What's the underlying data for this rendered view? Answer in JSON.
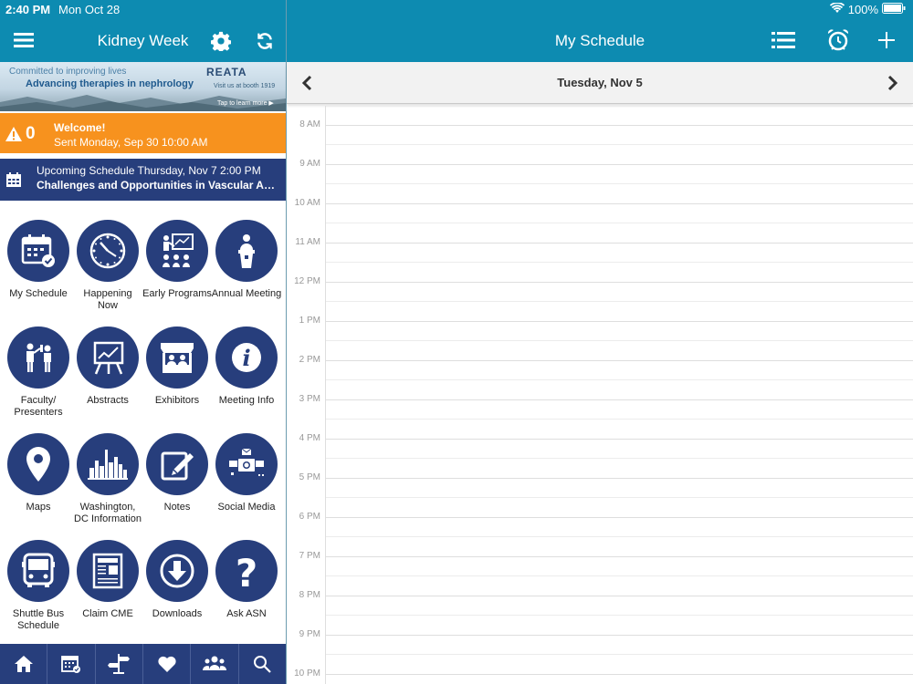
{
  "status": {
    "time": "2:40 PM",
    "date": "Mon Oct 28",
    "battery": "100%"
  },
  "left_header": {
    "title": "Kidney Week"
  },
  "right_header": {
    "title": "My Schedule"
  },
  "banner": {
    "tagline": "Committed to improving lives",
    "headline": "Advancing therapies in nephrology",
    "logo": "REATA",
    "booth": "Visit us at booth 1919",
    "cta": "Tap to learn more"
  },
  "alert": {
    "count": "0",
    "title": "Welcome!",
    "sent": "Sent Monday, Sep 30 10:00 AM"
  },
  "upcoming": {
    "line1": "Upcoming Schedule Thursday, Nov 7 2:00 PM",
    "line2": "Challenges and Opportunities in Vascular Access"
  },
  "tiles": [
    {
      "label": "My Schedule",
      "icon": "calendar-check-icon"
    },
    {
      "label": "Happening Now",
      "icon": "clock-icon"
    },
    {
      "label": "Early Programs",
      "icon": "presentation-audience-icon"
    },
    {
      "label": "Annual Meeting",
      "icon": "podium-speaker-icon"
    },
    {
      "label": "Faculty/ Presenters",
      "icon": "presenter-board-icon"
    },
    {
      "label": "Abstracts",
      "icon": "chart-easel-icon"
    },
    {
      "label": "Exhibitors",
      "icon": "booth-icon"
    },
    {
      "label": "Meeting Info",
      "icon": "info-icon"
    },
    {
      "label": "Maps",
      "icon": "map-pin-icon"
    },
    {
      "label": "Washington, DC Information",
      "icon": "skyline-icon"
    },
    {
      "label": "Notes",
      "icon": "notepad-pencil-icon"
    },
    {
      "label": "Social Media",
      "icon": "social-media-icon"
    },
    {
      "label": "Shuttle Bus Schedule",
      "icon": "bus-icon"
    },
    {
      "label": "Claim CME",
      "icon": "certificate-icon"
    },
    {
      "label": "Downloads",
      "icon": "download-icon"
    },
    {
      "label": "Ask ASN",
      "icon": "question-icon"
    }
  ],
  "tabbar": [
    "home-icon",
    "calendar-icon",
    "signpost-icon",
    "heart-icon",
    "people-icon",
    "search-icon"
  ],
  "datebar": {
    "date": "Tuesday, Nov 5"
  },
  "hours": [
    "8 AM",
    "9 AM",
    "10 AM",
    "11 AM",
    "12 PM",
    "1 PM",
    "2 PM",
    "3 PM",
    "4 PM",
    "5 PM",
    "6 PM",
    "7 PM",
    "8 PM",
    "9 PM",
    "10 PM"
  ],
  "colors": {
    "header": "#0d8bb1",
    "navy": "#273e7c",
    "alert": "#f7921e"
  }
}
